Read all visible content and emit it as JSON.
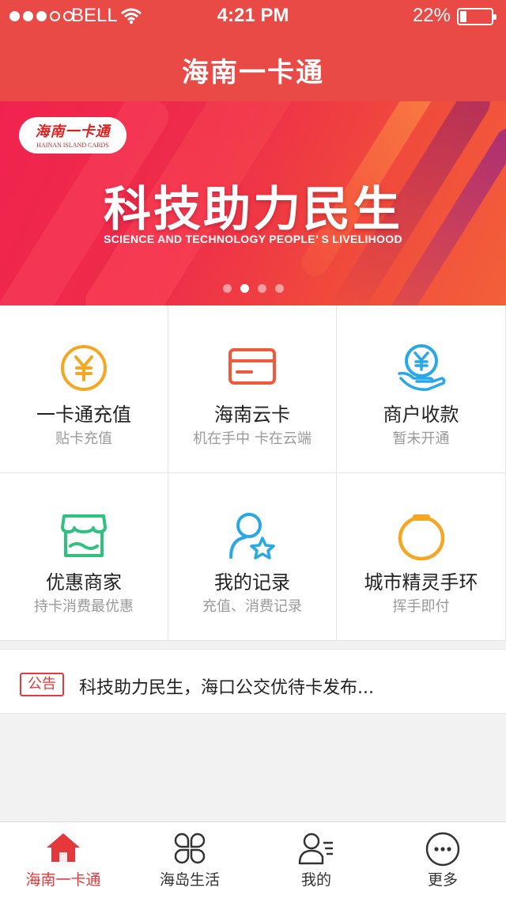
{
  "status_bar": {
    "carrier": "BELL",
    "time": "4:21 PM",
    "battery_percent": "22%",
    "battery_level": 0.22,
    "signal_bars_filled": 3,
    "signal_bars_total": 5
  },
  "header": {
    "title": "海南一卡通"
  },
  "banner": {
    "logo_main": "海南一卡通",
    "logo_sub": "HAINAN ISLAND CARDS",
    "slogan": "科技助力民生",
    "slogan_en": "SCIENCE AND TECHNOLOGY PEOPLE’ S LIVELIHOOD",
    "page_count": 4,
    "active_page": 2
  },
  "services": [
    {
      "label": "一卡通充值",
      "sub": "贴卡充值",
      "icon": "yuan-coin-icon",
      "color": "#f5a623"
    },
    {
      "label": "海南云卡",
      "sub": "机在手中 卡在云端",
      "icon": "card-icon",
      "color": "#ee5a3b"
    },
    {
      "label": "商户收款",
      "sub": "暂未开通",
      "icon": "hand-coin-icon",
      "color": "#29a8e8"
    },
    {
      "label": "优惠商家",
      "sub": "持卡消费最优惠",
      "icon": "store-icon",
      "color": "#2ec27e"
    },
    {
      "label": "我的记录",
      "sub": "充值、消费记录",
      "icon": "user-star-icon",
      "color": "#29a8e8"
    },
    {
      "label": "城市精灵手环",
      "sub": "挥手即付",
      "icon": "bracelet-icon",
      "color": "#f5a623"
    }
  ],
  "notice": {
    "tag": "公告",
    "text": "科技助力民生，海口公交优待卡发布..."
  },
  "tabs": [
    {
      "label": "海南一卡通",
      "icon": "home-icon",
      "active": true
    },
    {
      "label": "海岛生活",
      "icon": "clover-icon",
      "active": false
    },
    {
      "label": "我的",
      "icon": "profile-icon",
      "active": false
    },
    {
      "label": "更多",
      "icon": "more-icon",
      "active": false
    }
  ],
  "colors": {
    "accent": "#e94a45",
    "active_tab": "#e5383b"
  }
}
